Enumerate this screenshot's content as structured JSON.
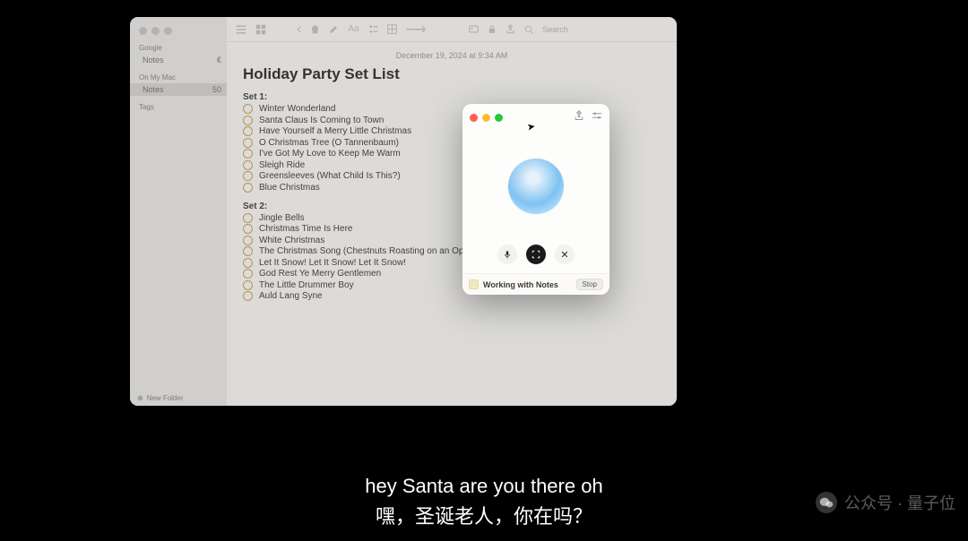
{
  "sidebar": {
    "section1": "Google",
    "item1": "Notes",
    "badge1": "€",
    "section2": "On My Mac",
    "item2": "Notes",
    "badge2": "50",
    "section3": "Tags",
    "footer": "New Folder"
  },
  "toolbar": {
    "searchPlaceholder": "Search"
  },
  "note": {
    "date": "December 19, 2024 at 9:34 AM",
    "title": "Holiday Party Set List",
    "set1Label": "Set 1:",
    "set1": [
      "Winter Wonderland",
      "Santa Claus Is Coming to Town",
      "Have Yourself a Merry Little Christmas",
      "O Christmas Tree (O Tannenbaum)",
      "I've Got My Love to Keep Me Warm",
      "Sleigh Ride",
      "Greensleeves (What Child Is This?)",
      "Blue Christmas"
    ],
    "set2Label": "Set 2:",
    "set2": [
      "Jingle Bells",
      "Christmas Time Is Here",
      "White Christmas",
      "The Christmas Song (Chestnuts Roasting on an Ope",
      "Let It Snow! Let It Snow! Let It Snow!",
      "God Rest Ye Merry Gentlemen",
      "The Little Drummer Boy",
      "Auld Lang Syne"
    ]
  },
  "assistant": {
    "status": "Working with Notes",
    "stop": "Stop"
  },
  "subtitle": {
    "en": "hey Santa are you there oh",
    "zh": "嘿，圣诞老人，你在吗？"
  },
  "watermark": {
    "label": "公众号 · 量子位"
  }
}
